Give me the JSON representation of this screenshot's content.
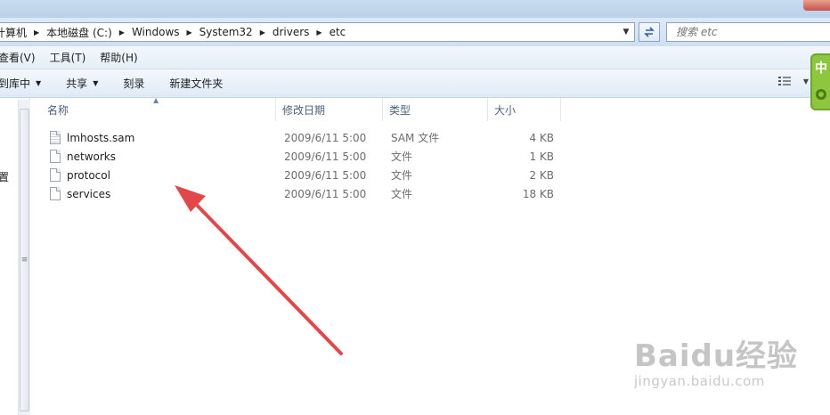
{
  "address": {
    "crumbs": [
      "计算机",
      "本地磁盘 (C:)",
      "Windows",
      "System32",
      "drivers",
      "etc"
    ]
  },
  "search": {
    "placeholder": "搜索 etc"
  },
  "menu": {
    "items": [
      "查看(V)",
      "工具(T)",
      "帮助(H)"
    ]
  },
  "commands": {
    "include_in_library": "到库中",
    "share": "共享",
    "burn": "刻录",
    "new_folder": "新建文件夹"
  },
  "ime": {
    "label": "中"
  },
  "nav": {
    "partial_label": "置"
  },
  "columns": {
    "name": "名称",
    "date": "修改日期",
    "type": "类型",
    "size": "大小"
  },
  "files": [
    {
      "name": "lmhosts.sam",
      "date": "2009/6/11 5:00",
      "type": "SAM 文件",
      "size": "4 KB",
      "icon": "sam-file-icon"
    },
    {
      "name": "networks",
      "date": "2009/6/11 5:00",
      "type": "文件",
      "size": "1 KB",
      "icon": "file-icon"
    },
    {
      "name": "protocol",
      "date": "2009/6/11 5:00",
      "type": "文件",
      "size": "2 KB",
      "icon": "file-icon"
    },
    {
      "name": "services",
      "date": "2009/6/11 5:00",
      "type": "文件",
      "size": "18 KB",
      "icon": "file-icon"
    }
  ],
  "watermark": {
    "logo": "Baidu经验",
    "url": "jingyan.baidu.com"
  },
  "colors": {
    "annotation_arrow": "#e0484a",
    "ime_green": "#8dc63f"
  }
}
